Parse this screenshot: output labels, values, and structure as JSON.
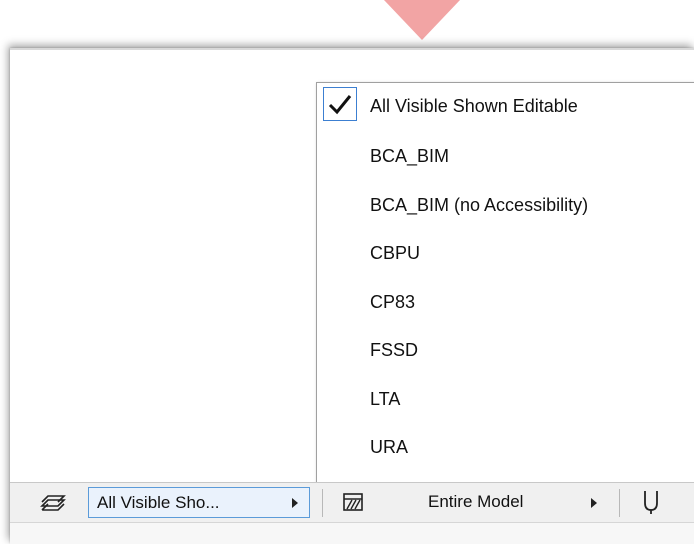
{
  "menu": {
    "items": [
      {
        "label": "All Visible Shown Editable",
        "checked": true
      },
      {
        "label": "BCA_BIM",
        "checked": false
      },
      {
        "label": "BCA_BIM (no Accessibility)",
        "checked": false
      },
      {
        "label": "CBPU",
        "checked": false
      },
      {
        "label": "CP83",
        "checked": false
      },
      {
        "label": "FSSD",
        "checked": false
      },
      {
        "label": "LTA",
        "checked": false
      },
      {
        "label": "URA",
        "checked": false
      }
    ]
  },
  "toolbar": {
    "layer_combination": "All Visible Sho...",
    "partial_structure": "Entire Model",
    "layers_icon": "layers-icon",
    "structure_icon": "structure-display-icon",
    "magnet_icon": "magnet-icon"
  },
  "colors": {
    "selection_border": "#5b9bd9",
    "selection_fill": "#eaf2fc",
    "check_border": "#3c7fd1"
  }
}
